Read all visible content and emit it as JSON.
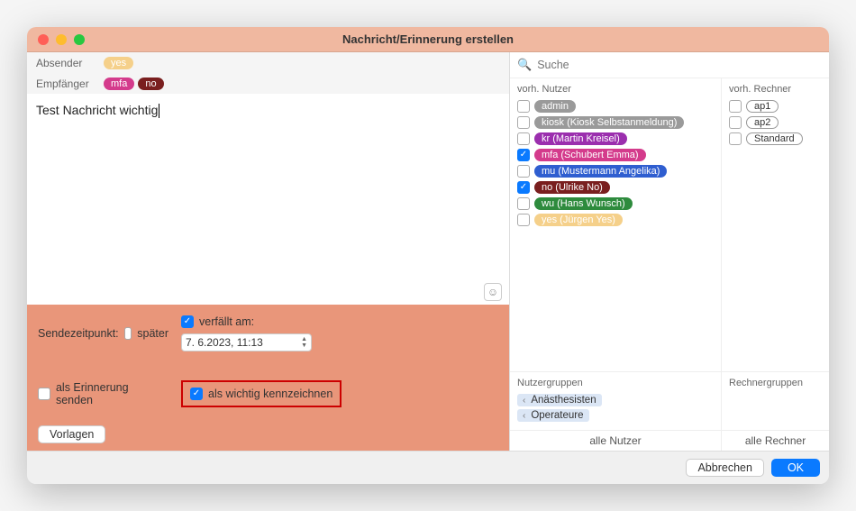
{
  "window": {
    "title": "Nachricht/Erinnerung erstellen"
  },
  "sender": {
    "label": "Absender",
    "tags": [
      {
        "text": "yes",
        "color": "#f5d08a"
      }
    ]
  },
  "recipients": {
    "label": "Empfänger",
    "tags": [
      {
        "text": "mfa",
        "color": "#d43b8c"
      },
      {
        "text": "no",
        "color": "#7a1f1f"
      }
    ]
  },
  "message": {
    "text": "Test Nachricht wichtig"
  },
  "options": {
    "send_time_label": "Sendezeitpunkt:",
    "later_label": "später",
    "expires_label": "verfällt am:",
    "expires_checked": true,
    "expires_value": "7.  6.2023, 11:13",
    "as_reminder_label": "als Erinnerung senden",
    "as_reminder_checked": false,
    "as_important_label": "als wichtig kennzeichnen",
    "as_important_checked": true
  },
  "templates_button": "Vorlagen",
  "search": {
    "placeholder": "Suche"
  },
  "users": {
    "header": "vorh. Nutzer",
    "items": [
      {
        "text": "admin",
        "color": "#9a9a9a",
        "checked": false
      },
      {
        "text": "kiosk (Kiosk Selbstanmeldung)",
        "color": "#9a9a9a",
        "checked": false
      },
      {
        "text": "kr (Martin Kreisel)",
        "color": "#9b2fae",
        "checked": false
      },
      {
        "text": "mfa (Schubert Emma)",
        "color": "#d43b8c",
        "checked": true
      },
      {
        "text": "mu (Mustermann Angelika)",
        "color": "#2f5ed0",
        "checked": false
      },
      {
        "text": "no (Ulrike No)",
        "color": "#7a1f1f",
        "checked": true
      },
      {
        "text": "wu (Hans Wunsch)",
        "color": "#2e8b3d",
        "checked": false
      },
      {
        "text": "yes (Jürgen Yes)",
        "color": "#f5d08a",
        "checked": false
      }
    ]
  },
  "computers": {
    "header": "vorh. Rechner",
    "items": [
      {
        "text": "ap1"
      },
      {
        "text": "ap2"
      },
      {
        "text": "Standard"
      }
    ]
  },
  "user_groups": {
    "header": "Nutzergruppen",
    "items": [
      "Anästhesisten",
      "Operateure"
    ]
  },
  "computer_groups": {
    "header": "Rechnergruppen"
  },
  "all_users_button": "alle Nutzer",
  "all_computers_button": "alle Rechner",
  "footer": {
    "cancel": "Abbrechen",
    "ok": "OK"
  }
}
